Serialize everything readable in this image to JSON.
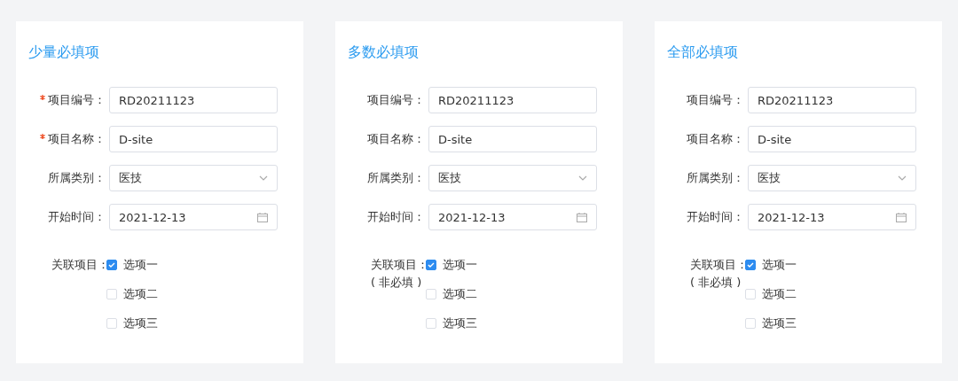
{
  "cards": [
    {
      "title": "少量必填项",
      "fields": [
        {
          "kind": "text",
          "label": "项目编号：",
          "required": true,
          "value": "RD20211123"
        },
        {
          "kind": "text",
          "label": "项目名称：",
          "required": true,
          "value": "D-site"
        },
        {
          "kind": "select",
          "label": "所属类别：",
          "required": false,
          "value": "医技"
        },
        {
          "kind": "date",
          "label": "开始时间：",
          "required": false,
          "value": "2021-12-13"
        }
      ],
      "related": {
        "label": "关联项目：",
        "options": [
          {
            "label": "选项一",
            "checked": true
          },
          {
            "label": "选项二",
            "checked": false
          },
          {
            "label": "选项三",
            "checked": false
          }
        ]
      }
    },
    {
      "title": "多数必填项",
      "fields": [
        {
          "kind": "text",
          "label": "项目编号：",
          "required": false,
          "value": "RD20211123"
        },
        {
          "kind": "text",
          "label": "项目名称：",
          "required": false,
          "value": "D-site"
        },
        {
          "kind": "select",
          "label": "所属类别：",
          "required": false,
          "value": "医技"
        },
        {
          "kind": "date",
          "label": "开始时间：",
          "required": false,
          "value": "2021-12-13"
        }
      ],
      "related": {
        "label": "关联项目：",
        "note": "( 非必填 )",
        "options": [
          {
            "label": "选项一",
            "checked": true
          },
          {
            "label": "选项二",
            "checked": false
          },
          {
            "label": "选项三",
            "checked": false
          }
        ]
      }
    },
    {
      "title": "全部必填项",
      "fields": [
        {
          "kind": "text",
          "label": "项目编号：",
          "required": false,
          "value": "RD20211123"
        },
        {
          "kind": "text",
          "label": "项目名称：",
          "required": false,
          "value": "D-site"
        },
        {
          "kind": "select",
          "label": "所属类别：",
          "required": false,
          "value": "医技"
        },
        {
          "kind": "date",
          "label": "开始时间：",
          "required": false,
          "value": "2021-12-13"
        }
      ],
      "related": {
        "label": "关联项目：",
        "note": "( 非必填 )",
        "options": [
          {
            "label": "选项一",
            "checked": true
          },
          {
            "label": "选项二",
            "checked": false
          },
          {
            "label": "选项三",
            "checked": false
          }
        ]
      }
    }
  ]
}
